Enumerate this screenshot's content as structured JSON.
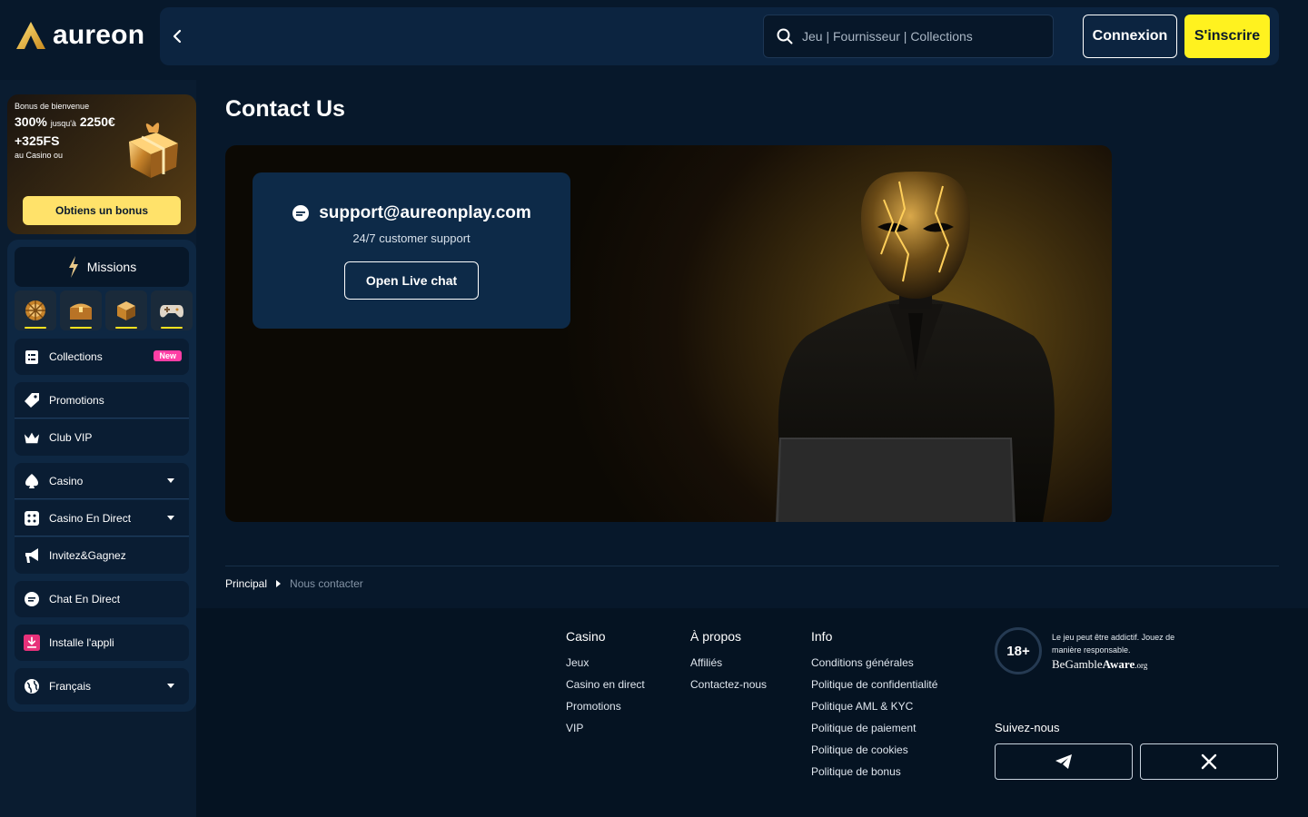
{
  "brand": {
    "name": "aureon",
    "accent": "#fff21f",
    "bg": "#07182b"
  },
  "header": {
    "search_placeholder": "Jeu | Fournisseur | Collections",
    "login_label": "Connexion",
    "signup_label": "S'inscrire"
  },
  "bonus": {
    "line1": "Bonus de bienvenue",
    "pct": "300%",
    "upto": "jusqu'à",
    "amount": "2250€",
    "fs": "+325FS",
    "sub": "au Casino ou",
    "button": "Obtiens un bonus"
  },
  "sidebar": {
    "missions": "Missions",
    "items": [
      {
        "label": "Collections",
        "badge": "New"
      },
      {
        "label": "Promotions"
      },
      {
        "label": "Club VIP"
      },
      {
        "label": "Casino"
      },
      {
        "label": "Casino En Direct"
      },
      {
        "label": "Invitez&Gagnez"
      },
      {
        "label": "Chat En Direct"
      },
      {
        "label": "Installe l'appli"
      },
      {
        "label": "Français"
      }
    ]
  },
  "main": {
    "title": "Contact Us",
    "email": "support@aureonplay.com",
    "support_text": "24/7 customer support",
    "live_chat_button": "Open Live chat"
  },
  "breadcrumb": {
    "home": "Principal",
    "current": "Nous contacter"
  },
  "footer": {
    "casino": {
      "title": "Casino",
      "links": [
        "Jeux",
        "Casino en direct",
        "Promotions",
        "VIP"
      ]
    },
    "about": {
      "title": "À propos",
      "links": [
        "Affiliés",
        "Contactez-nous"
      ]
    },
    "info": {
      "title": "Info",
      "links": [
        "Conditions générales",
        "Politique de confidentialité",
        "Politique AML & KYC",
        "Politique de paiement",
        "Politique de cookies",
        "Politique de bonus"
      ]
    },
    "age": "18+",
    "gamble_text": "Le jeu peut être addictif. Jouez de manière responsable.",
    "bga_be": "Be",
    "bga_gamble": "Gamble",
    "bga_aware": "Aware",
    "bga_org": ".org",
    "follow": "Suivez-nous"
  }
}
